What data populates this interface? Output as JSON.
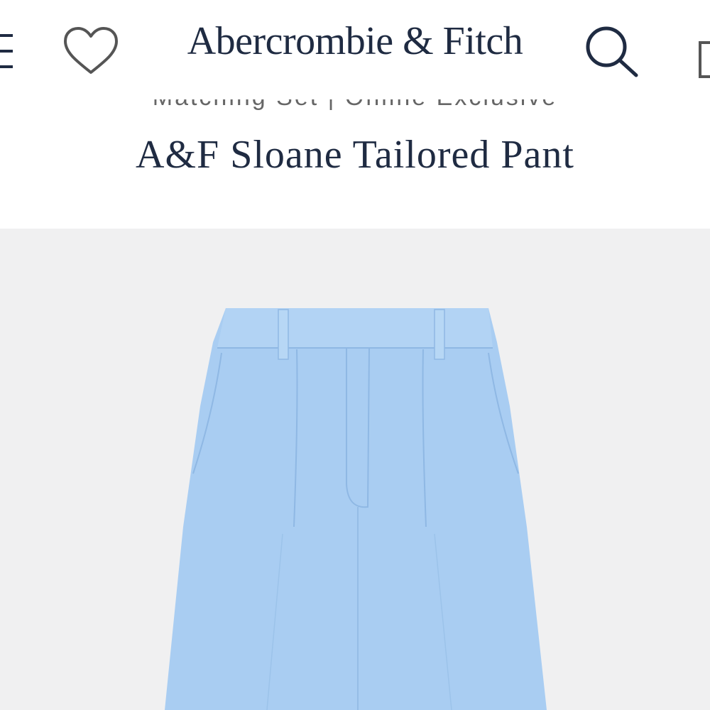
{
  "header": {
    "brand": "Abercrombie & Fitch",
    "icons": {
      "menu": "menu-icon",
      "wishlist": "heart-icon",
      "search": "search-icon",
      "bag": "bag-icon"
    }
  },
  "product": {
    "collection": "Matching Set | Online Exclusive",
    "title": "A&F Sloane Tailored Pant"
  },
  "colors": {
    "brand_navy": "#1f2b42",
    "image_background": "#f0f0f1",
    "pant_blue": "#a9cdf2"
  }
}
